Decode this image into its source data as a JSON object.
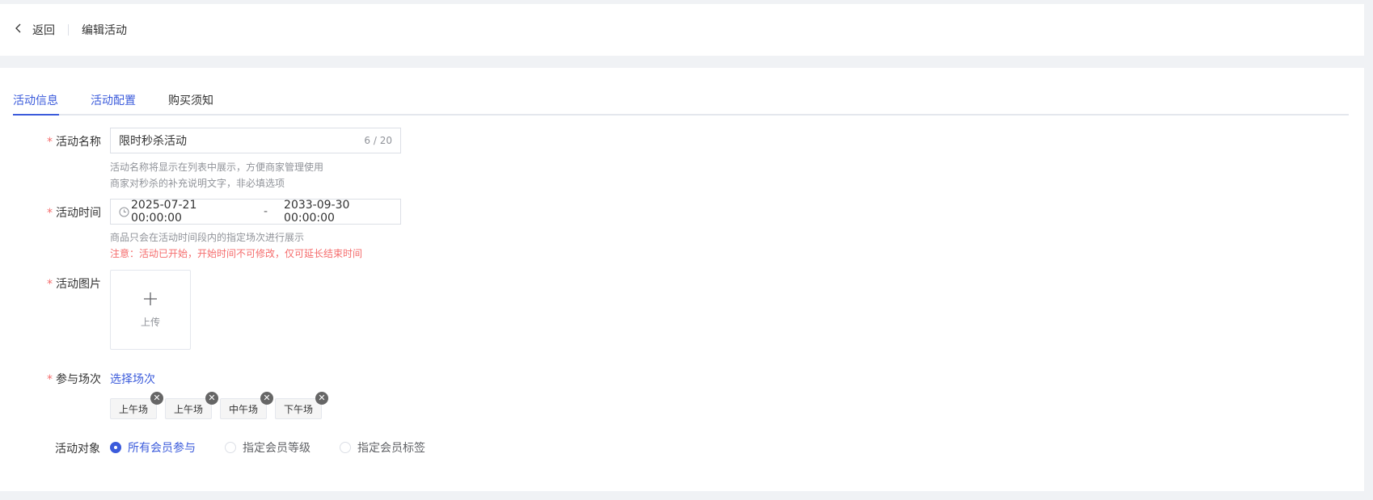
{
  "header": {
    "back_label": "返回",
    "title": "编辑活动"
  },
  "tabs": [
    {
      "label": "活动信息",
      "active": true
    },
    {
      "label": "活动配置",
      "active": false
    },
    {
      "label": "购买须知",
      "active": false
    }
  ],
  "form": {
    "name": {
      "required": "*",
      "label": "活动名称",
      "value": "限时秒杀活动",
      "count": "6 / 20",
      "hint1": "活动名称将显示在列表中展示，方便商家管理使用",
      "hint2": "商家对秒杀的补充说明文字，非必填选项"
    },
    "time": {
      "required": "*",
      "label": "活动时间",
      "start": "2025-07-21 00:00:00",
      "separator": "-",
      "end": "2033-09-30 00:00:00",
      "hint": "商品只会在活动时间段内的指定场次进行展示",
      "warning": "注意：活动已开始，开始时间不可修改，仅可延长结束时间"
    },
    "image": {
      "required": "*",
      "label": "活动图片",
      "upload_label": "上传"
    },
    "sessions": {
      "required": "*",
      "label": "参与场次",
      "select_link": "选择场次",
      "tags": [
        "上午场",
        "上午场",
        "中午场",
        "下午场"
      ],
      "close_glyph": "✕"
    },
    "audience": {
      "label": "活动对象",
      "options": [
        {
          "label": "所有会员参与",
          "checked": true
        },
        {
          "label": "指定会员等级",
          "checked": false
        },
        {
          "label": "指定会员标签",
          "checked": false
        }
      ]
    }
  },
  "colors": {
    "accent": "#3b5bdb",
    "required": "#f56c6c",
    "hint": "#909399",
    "background": "#f0f2f5"
  }
}
